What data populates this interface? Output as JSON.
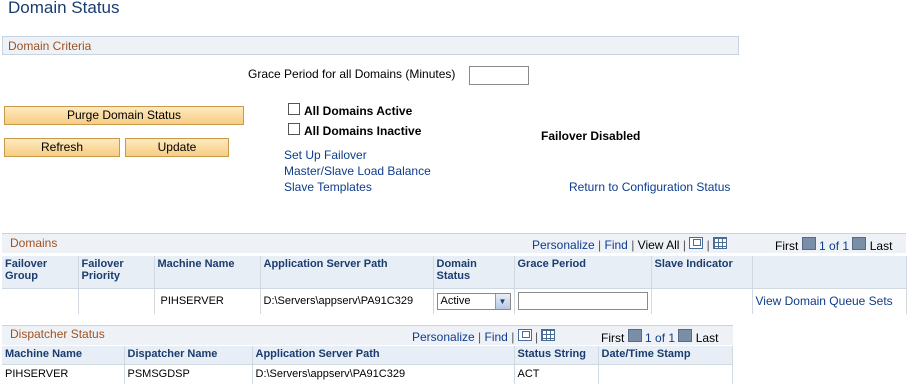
{
  "page": {
    "title": "Domain Status"
  },
  "criteria": {
    "section_title": "Domain Criteria",
    "grace_period_label": "Grace Period for all Domains (Minutes)",
    "grace_period_value": ""
  },
  "buttons": {
    "purge": "Purge Domain Status",
    "refresh": "Refresh",
    "update": "Update"
  },
  "checkboxes": {
    "all_active": {
      "label": "All Domains Active",
      "checked": false
    },
    "all_inactive": {
      "label": "All Domains Inactive",
      "checked": false
    }
  },
  "failover_status": "Failover Disabled",
  "links": {
    "setup_failover": "Set Up Failover",
    "master_slave": "Master/Slave Load Balance",
    "slave_templates": "Slave Templates",
    "return_config": "Return to Configuration Status"
  },
  "domains": {
    "title": "Domains",
    "nav": {
      "personalize": "Personalize",
      "find": "Find",
      "view_all": "View All",
      "first": "First",
      "range": "1 of 1",
      "last": "Last"
    },
    "columns": [
      "Failover Group",
      "Failover Priority",
      "Machine Name",
      "Application Server Path",
      "Domain Status",
      "Grace Period",
      "Slave Indicator",
      ""
    ],
    "rows": [
      {
        "failover_group": "",
        "failover_priority": "",
        "machine_name": "PIHSERVER",
        "app_server_path": "D:\\Servers\\appserv\\PA91C329",
        "domain_status": "Active",
        "grace_period": "",
        "slave_indicator": "",
        "action": "View Domain Queue Sets"
      }
    ]
  },
  "dispatcher": {
    "title": "Dispatcher Status",
    "nav": {
      "personalize": "Personalize",
      "find": "Find",
      "first": "First",
      "range": "1 of 1",
      "last": "Last"
    },
    "columns": [
      "Machine Name",
      "Dispatcher Name",
      "Application Server Path",
      "Status String",
      "Date/Time Stamp"
    ],
    "rows": [
      {
        "machine_name": "PIHSERVER",
        "dispatcher_name": "PSMSGDSP",
        "app_server_path": "D:\\Servers\\appserv\\PA91C329",
        "status_string": "ACT",
        "timestamp": ""
      }
    ]
  }
}
